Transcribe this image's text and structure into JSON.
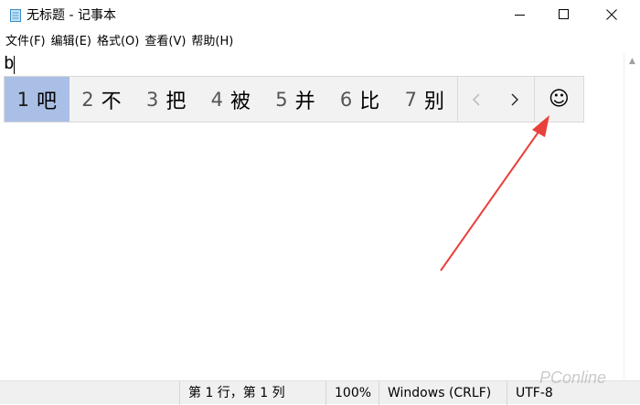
{
  "window": {
    "title": "无标题 - 记事本",
    "controls": {
      "minimize": "minimize",
      "maximize": "maximize",
      "close": "close"
    }
  },
  "menu": {
    "items": [
      {
        "label": "文件(F)"
      },
      {
        "label": "编辑(E)"
      },
      {
        "label": "格式(O)"
      },
      {
        "label": "查看(V)"
      },
      {
        "label": "帮助(H)"
      }
    ]
  },
  "editor": {
    "content": "b"
  },
  "ime": {
    "candidates": [
      {
        "num": "1",
        "text": "吧",
        "selected": true
      },
      {
        "num": "2",
        "text": "不"
      },
      {
        "num": "3",
        "text": "把"
      },
      {
        "num": "4",
        "text": "被"
      },
      {
        "num": "5",
        "text": "并"
      },
      {
        "num": "6",
        "text": "比"
      },
      {
        "num": "7",
        "text": "别"
      }
    ],
    "prev_icon": "chevron-left-icon",
    "next_icon": "chevron-right-icon",
    "emoji_glyph": "☺",
    "selected_color": "#a9bfe5"
  },
  "annotation": {
    "arrow_color": "#e8403a"
  },
  "statusbar": {
    "position": "第 1 行，第 1 列",
    "zoom": "100%",
    "line_ending": "Windows (CRLF)",
    "encoding": "UTF-8"
  },
  "watermark": {
    "text": "PConline"
  }
}
